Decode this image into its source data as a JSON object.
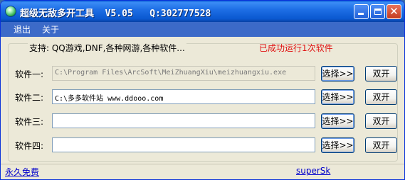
{
  "window": {
    "title": "超级无敌多开工具  V5.05   Q:302777528",
    "controls": {
      "minimize": "minimize",
      "maximize": "maximize",
      "close": "close"
    }
  },
  "menu": {
    "items": [
      "退出",
      "关于"
    ]
  },
  "info": {
    "support": "支持: QQ游戏,DNF,各种网游,各种软件...",
    "status": "已成功运行1次软件"
  },
  "rows": [
    {
      "label": "软件一:",
      "value": "C:\\Program Files\\ArcSoft\\MeiZhuangXiu\\meizhuangxiu.exe",
      "disabled": true,
      "select_label": "选择>>",
      "dual_label": "双开"
    },
    {
      "label": "软件二:",
      "value": "C:\\多多软件站 www.ddooo.com",
      "disabled": false,
      "select_label": "选择>>",
      "dual_label": "双开"
    },
    {
      "label": "软件三:",
      "value": "",
      "disabled": false,
      "select_label": "选择>>",
      "dual_label": "双开"
    },
    {
      "label": "软件四:",
      "value": "",
      "disabled": false,
      "select_label": "选择>>",
      "dual_label": "双开"
    }
  ],
  "footer": {
    "left_link": "永久免费",
    "right_link": "superSk"
  },
  "colors": {
    "titlebar": "#0a58d0",
    "menubar": "#3c6ac8",
    "status_text": "#e01010",
    "link": "#0000cc"
  }
}
